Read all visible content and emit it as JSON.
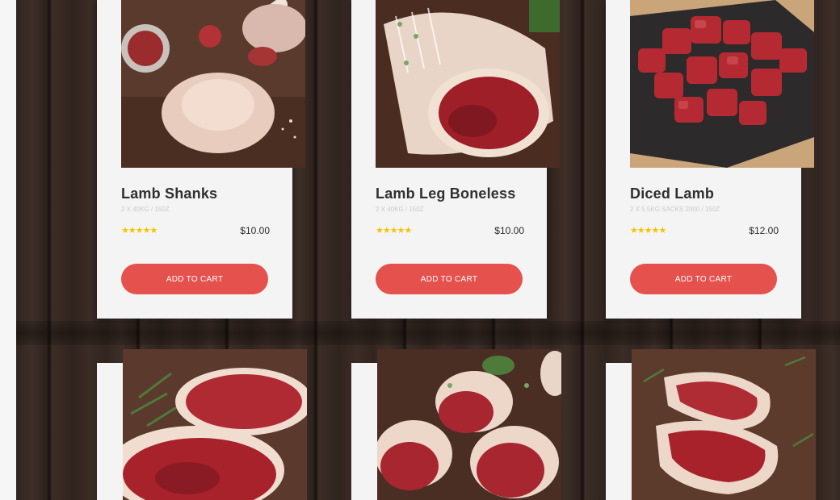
{
  "products": [
    {
      "name": "Lamb Shanks",
      "subtitle": "2 X 40KG / 150Z",
      "rating": 5,
      "stars": "★★★★★",
      "price": "$10.00",
      "button": "ADD TO CART",
      "image": "lamb-shanks-photo"
    },
    {
      "name": "Lamb Leg Boneless",
      "subtitle": "2 X 40KG / 150Z",
      "rating": 5,
      "stars": "★★★★★",
      "price": "$10.00",
      "button": "ADD TO CART",
      "image": "lamb-leg-boneless-photo"
    },
    {
      "name": "Diced Lamb",
      "subtitle": "2 X 5.5KG SACKS 2000 / 150Z",
      "rating": 5,
      "stars": "★★★★★",
      "price": "$12.00",
      "button": "ADD TO CART",
      "image": "diced-lamb-photo"
    }
  ],
  "bottom_row_images": [
    "lamb-rump-photo",
    "lamb-rolls-photo",
    "lamb-chops-photo"
  ],
  "colors": {
    "button": "#e5524d",
    "stars": "#f4c400",
    "card": "#f4f4f4",
    "background": "#2d2320"
  }
}
